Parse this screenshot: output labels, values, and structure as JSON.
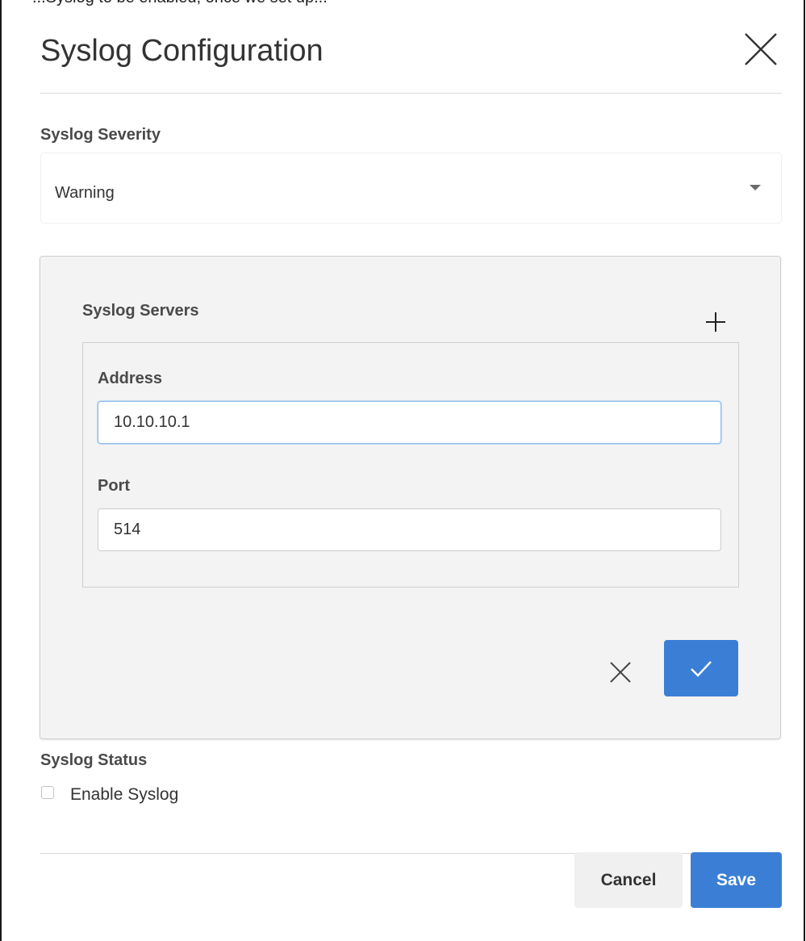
{
  "top_clipped_text": "...Syslog to be enabled, once we set up...",
  "modal": {
    "title": "Syslog Configuration"
  },
  "severity": {
    "label": "Syslog Severity",
    "selected": "Warning"
  },
  "servers": {
    "label": "Syslog Servers",
    "address_label": "Address",
    "address_value": "10.10.10.1",
    "port_label": "Port",
    "port_value": "514"
  },
  "status": {
    "label": "Syslog Status",
    "enable_label": "Enable Syslog",
    "enabled": false
  },
  "footer": {
    "cancel_label": "Cancel",
    "save_label": "Save"
  },
  "icons": {
    "close": "close-icon",
    "add": "plus-icon",
    "discard": "close-icon",
    "confirm": "check-icon",
    "dropdown": "caret-down-icon"
  },
  "colors": {
    "primary": "#3a7fd5",
    "panel_bg": "#f3f3f3",
    "input_focus": "#8fbcec"
  }
}
